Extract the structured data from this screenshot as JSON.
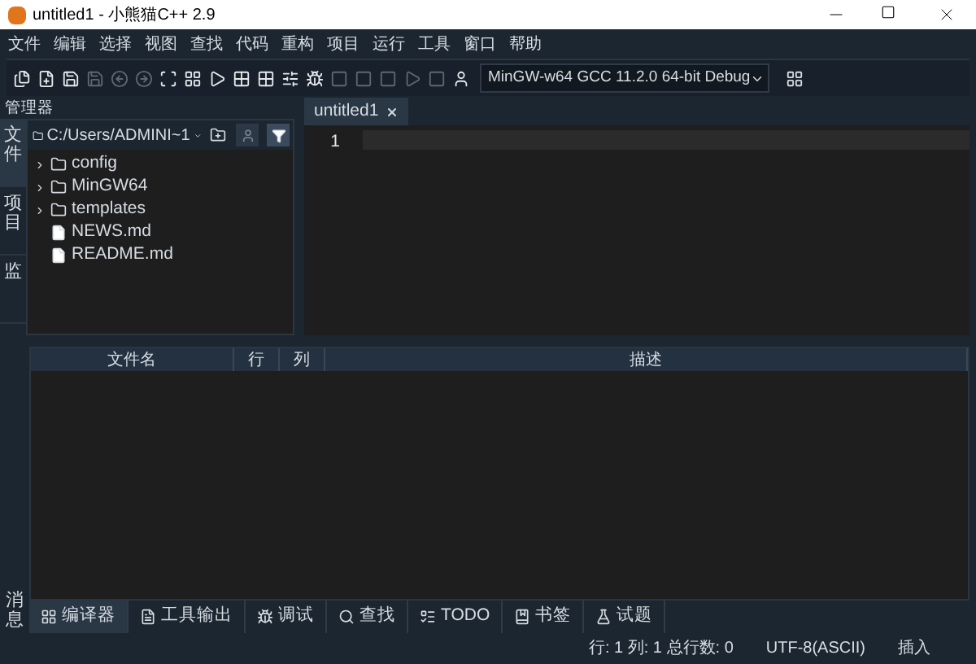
{
  "window": {
    "title": "untitled1 - 小熊猫C++ 2.9"
  },
  "menu": [
    "文件",
    "编辑",
    "选择",
    "视图",
    "查找",
    "代码",
    "重构",
    "项目",
    "运行",
    "工具",
    "窗口",
    "帮助"
  ],
  "toolbar": {
    "compiler": "MinGW-w64 GCC 11.2.0 64-bit Debug"
  },
  "manager": {
    "title": "管理器",
    "side_tabs": [
      {
        "label": "文件",
        "selected": true
      },
      {
        "label": "项目",
        "selected": false
      },
      {
        "label": "监",
        "selected": false
      }
    ],
    "path": "C:/Users/ADMINI~1",
    "tree": [
      {
        "name": "config",
        "kind": "folder"
      },
      {
        "name": "MinGW64",
        "kind": "folder"
      },
      {
        "name": "templates",
        "kind": "folder"
      },
      {
        "name": "NEWS.md",
        "kind": "file"
      },
      {
        "name": "README.md",
        "kind": "file"
      }
    ]
  },
  "editor": {
    "tabs": [
      {
        "label": "untitled1",
        "selected": true
      }
    ],
    "line_numbers": [
      "1"
    ]
  },
  "messages": {
    "side_tab": "消息",
    "columns": [
      "文件名",
      "行",
      "列",
      "描述"
    ],
    "tabs": [
      {
        "label": "编译器",
        "selected": true
      },
      {
        "label": "工具输出",
        "selected": false
      },
      {
        "label": "调试",
        "selected": false
      },
      {
        "label": "查找",
        "selected": false
      },
      {
        "label": "TODO",
        "selected": false
      },
      {
        "label": "书签",
        "selected": false
      },
      {
        "label": "试题",
        "selected": false
      }
    ]
  },
  "status_bar": {
    "position": "行: 1 列: 1 总行数: 0",
    "encoding": "UTF-8(ASCII)",
    "mode": "插入"
  }
}
